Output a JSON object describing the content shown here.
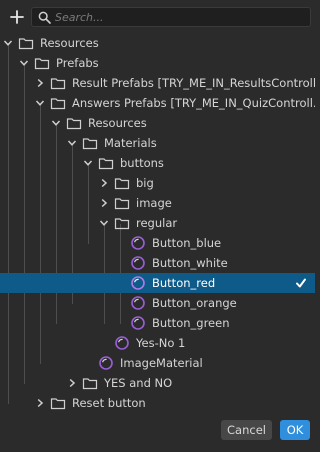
{
  "search": {
    "placeholder": "Search..."
  },
  "colors": {
    "background": "#2b2b2b",
    "selected_row": "#0e5a88",
    "material_icon": "#9a5fd6",
    "ok_button": "#2f8fdc"
  },
  "tree": {
    "items": [
      {
        "label": "Resources",
        "kind": "folder",
        "expanded": true,
        "icon": "folder-icon"
      },
      {
        "label": "Prefabs",
        "kind": "folder",
        "expanded": true,
        "icon": "folder-icon"
      },
      {
        "label": "Result Prefabs [TRY_ME_IN_ResultsControll...",
        "kind": "folder",
        "expanded": false,
        "icon": "folder-icon"
      },
      {
        "label": "Answers Prefabs [TRY_ME_IN_QuizControll...",
        "kind": "folder",
        "expanded": true,
        "icon": "folder-icon"
      },
      {
        "label": "Resources",
        "kind": "folder",
        "expanded": true,
        "icon": "folder-icon"
      },
      {
        "label": "Materials",
        "kind": "folder",
        "expanded": true,
        "icon": "folder-icon"
      },
      {
        "label": "buttons",
        "kind": "folder",
        "expanded": true,
        "icon": "folder-icon"
      },
      {
        "label": "big",
        "kind": "folder",
        "expanded": false,
        "icon": "folder-icon"
      },
      {
        "label": "image",
        "kind": "folder",
        "expanded": false,
        "icon": "folder-icon"
      },
      {
        "label": "regular",
        "kind": "folder",
        "expanded": true,
        "icon": "folder-icon"
      },
      {
        "label": "Button_blue",
        "kind": "material",
        "icon": "material-icon"
      },
      {
        "label": "Button_white",
        "kind": "material",
        "icon": "material-icon"
      },
      {
        "label": "Button_red",
        "kind": "material",
        "icon": "material-icon",
        "selected": true
      },
      {
        "label": "Button_orange",
        "kind": "material",
        "icon": "material-icon"
      },
      {
        "label": "Button_green",
        "kind": "material",
        "icon": "material-icon"
      },
      {
        "label": "Yes-No 1",
        "kind": "material",
        "icon": "material-icon"
      },
      {
        "label": "ImageMaterial",
        "kind": "material",
        "icon": "material-icon"
      },
      {
        "label": "YES and NO",
        "kind": "folder",
        "expanded": false,
        "icon": "folder-icon"
      },
      {
        "label": "Reset button",
        "kind": "folder",
        "expanded": false,
        "icon": "folder-icon"
      }
    ]
  },
  "footer": {
    "cancel_label": "Cancel",
    "ok_label": "OK"
  }
}
